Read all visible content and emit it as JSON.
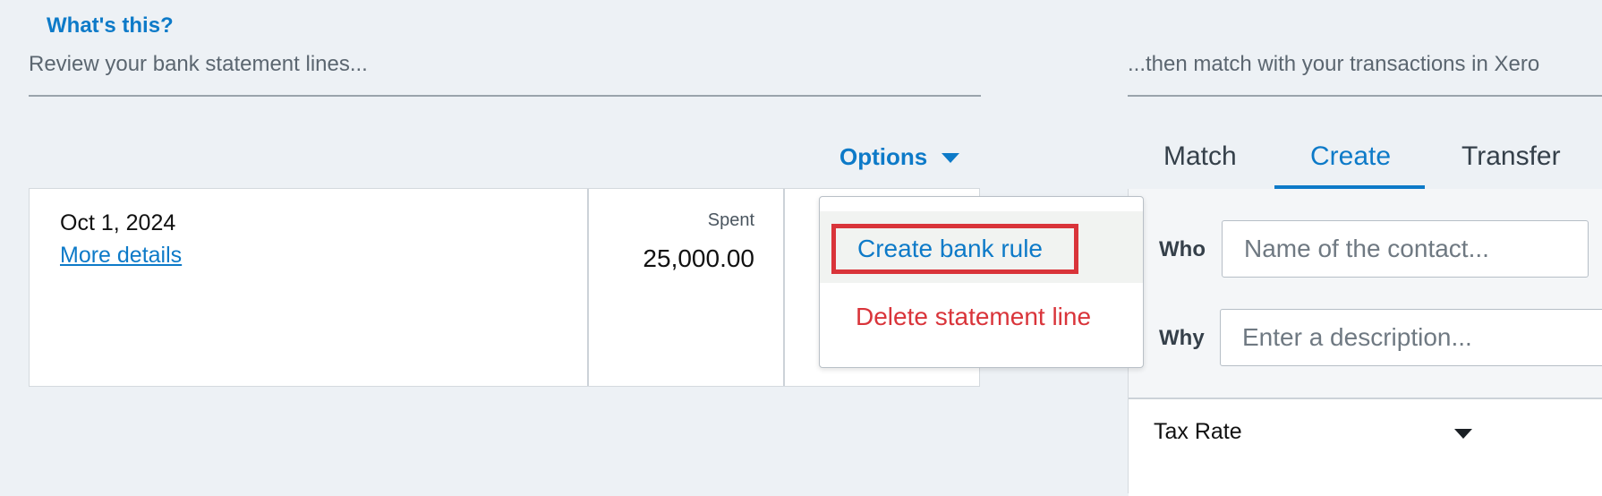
{
  "header": {
    "whats_this": "What's this?",
    "left_heading": "Review your bank statement lines...",
    "right_heading": "...then match with your transactions in Xero"
  },
  "options": {
    "label": "Options",
    "menu": {
      "create_rule": "Create bank rule",
      "delete_line": "Delete statement line"
    }
  },
  "statement": {
    "date": "Oct 1, 2024",
    "more_details": "More details",
    "spent_label": "Spent",
    "spent_amount": "25,000.00"
  },
  "tabs": [
    {
      "label": "Match",
      "active": false
    },
    {
      "label": "Create",
      "active": true
    },
    {
      "label": "Transfer",
      "active": false
    }
  ],
  "form": {
    "who_label": "Who",
    "who_placeholder": "Name of the contact...",
    "why_label": "Why",
    "why_placeholder": "Enter a description...",
    "tax_rate_label": "Tax Rate"
  },
  "colors": {
    "accent": "#0d7ac8",
    "danger": "#d9343a",
    "background": "#edf1f5"
  }
}
